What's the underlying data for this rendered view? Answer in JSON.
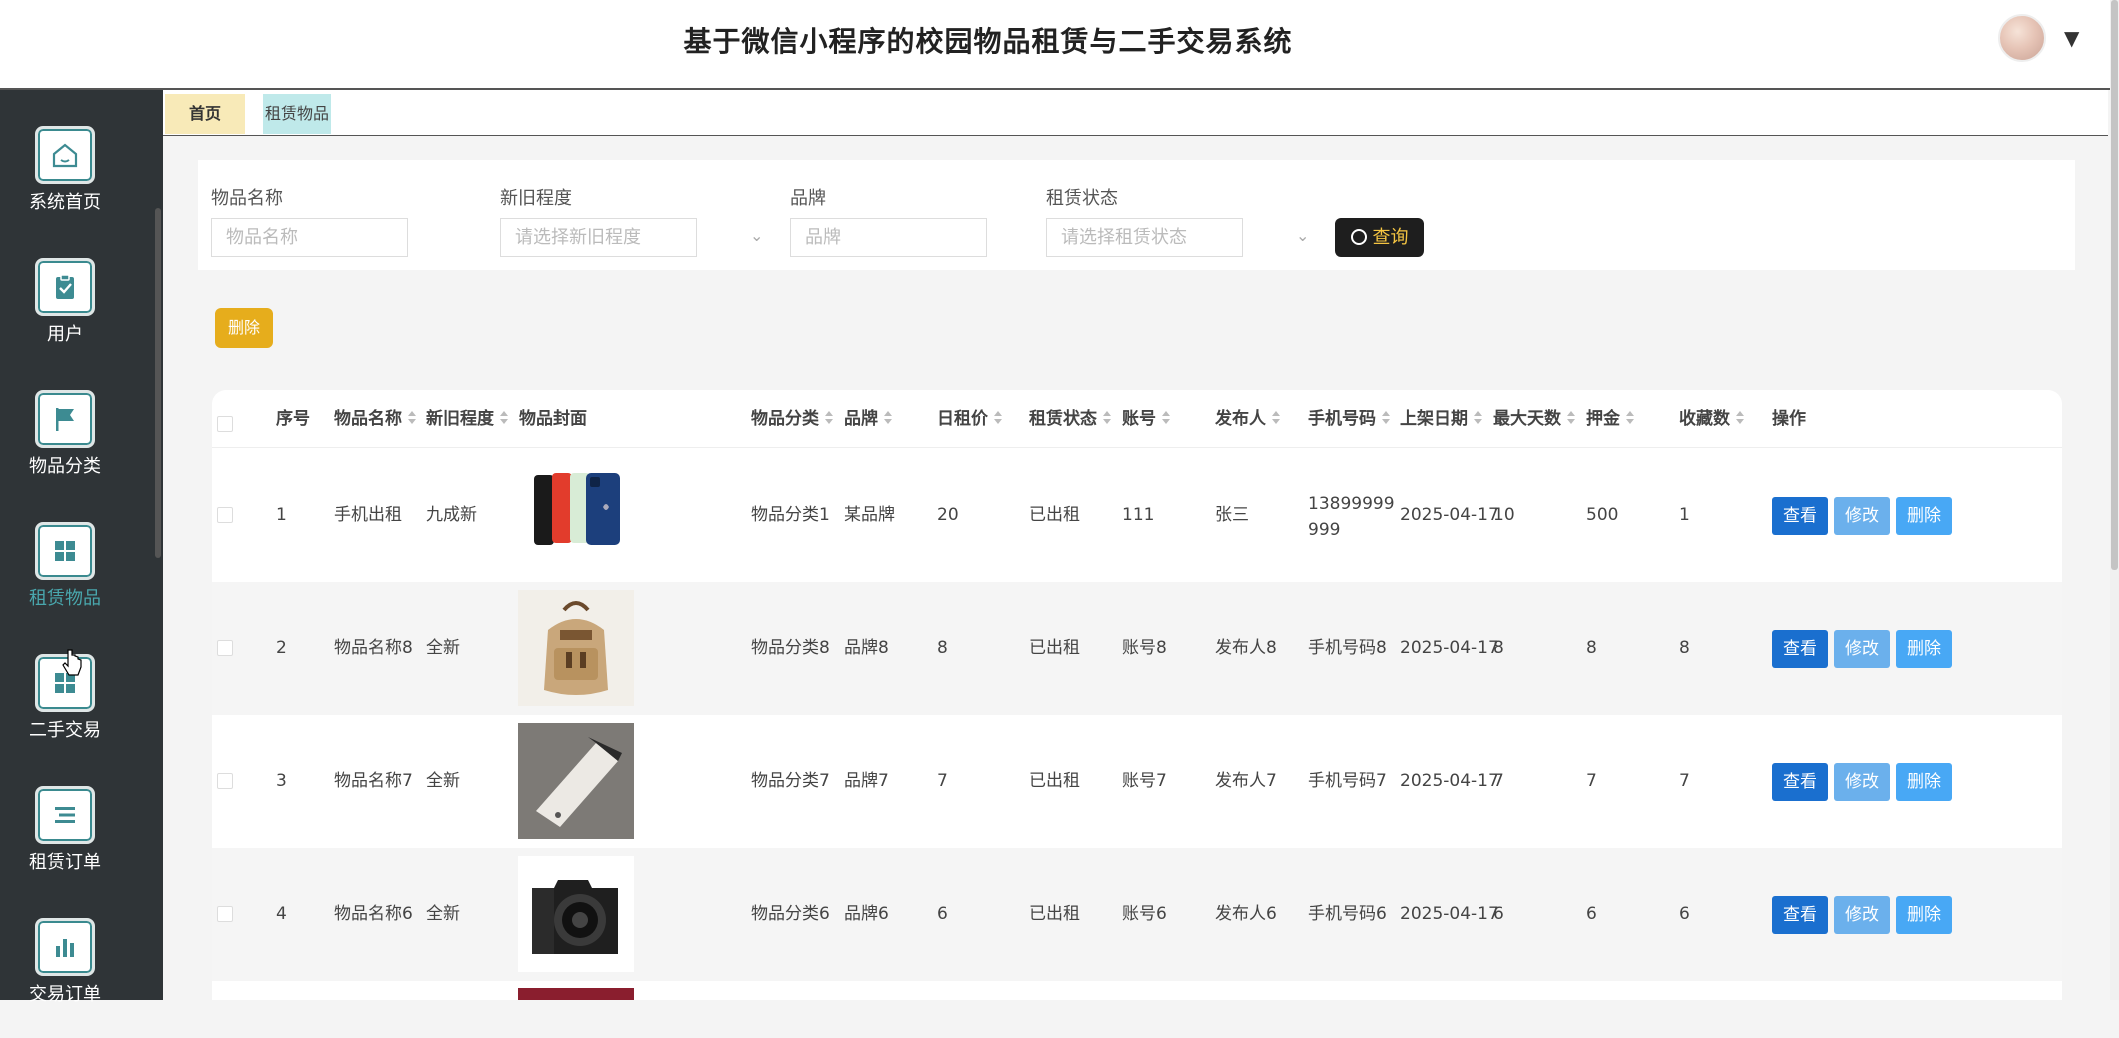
{
  "app": {
    "title": "基于微信小程序的校园物品租赁与二手交易系统"
  },
  "sidebar": {
    "items": [
      {
        "label": "系统首页",
        "icon": "home-icon"
      },
      {
        "label": "用户",
        "icon": "clipboard-check-icon"
      },
      {
        "label": "物品分类",
        "icon": "flag-icon"
      },
      {
        "label": "租赁物品",
        "icon": "grid-icon",
        "active": true
      },
      {
        "label": "二手交易",
        "icon": "grid-icon"
      },
      {
        "label": "租赁订单",
        "icon": "list-icon"
      },
      {
        "label": "交易订单",
        "icon": "bar-chart-icon"
      }
    ]
  },
  "tabs": [
    {
      "label": "首页"
    },
    {
      "label": "租赁物品"
    }
  ],
  "filters": {
    "name": {
      "label": "物品名称",
      "placeholder": "物品名称"
    },
    "condition": {
      "label": "新旧程度",
      "placeholder": "请选择新旧程度"
    },
    "brand": {
      "label": "品牌",
      "placeholder": "品牌"
    },
    "status": {
      "label": "租赁状态",
      "placeholder": "请选择租赁状态"
    },
    "query_label": "查询"
  },
  "bulk_delete_label": "删除",
  "table": {
    "headers": {
      "seq": "序号",
      "name": "物品名称",
      "condition": "新旧程度",
      "cover": "物品封面",
      "category": "物品分类",
      "brand": "品牌",
      "daily": "日租价",
      "status": "租赁状态",
      "account": "账号",
      "publisher": "发布人",
      "phone": "手机号码",
      "date": "上架日期",
      "maxdays": "最大天数",
      "deposit": "押金",
      "favs": "收藏数",
      "actions": "操作"
    },
    "rows": [
      {
        "seq": "1",
        "name": "手机出租",
        "condition": "九成新",
        "category": "物品分类1",
        "brand": "某品牌",
        "daily": "20",
        "status": "已出租",
        "account": "111",
        "publisher": "张三",
        "phone": "13899999999",
        "date": "2025-04-17",
        "maxdays": "10",
        "deposit": "500",
        "favs": "1",
        "cover": "phones"
      },
      {
        "seq": "2",
        "name": "物品名称8",
        "condition": "全新",
        "category": "物品分类8",
        "brand": "品牌8",
        "daily": "8",
        "status": "已出租",
        "account": "账号8",
        "publisher": "发布人8",
        "phone": "手机号码8",
        "date": "2025-04-17",
        "maxdays": "8",
        "deposit": "8",
        "favs": "8",
        "cover": "backpack"
      },
      {
        "seq": "3",
        "name": "物品名称7",
        "condition": "全新",
        "category": "物品分类7",
        "brand": "品牌7",
        "daily": "7",
        "status": "已出租",
        "account": "账号7",
        "publisher": "发布人7",
        "phone": "手机号码7",
        "date": "2025-04-17",
        "maxdays": "7",
        "deposit": "7",
        "favs": "7",
        "cover": "hair-clipper"
      },
      {
        "seq": "4",
        "name": "物品名称6",
        "condition": "全新",
        "category": "物品分类6",
        "brand": "品牌6",
        "daily": "6",
        "status": "已出租",
        "account": "账号6",
        "publisher": "发布人6",
        "phone": "手机号码6",
        "date": "2025-04-17",
        "maxdays": "6",
        "deposit": "6",
        "favs": "6",
        "cover": "camera"
      }
    ],
    "action_labels": {
      "view": "查看",
      "edit": "修改",
      "delete": "删除"
    }
  }
}
